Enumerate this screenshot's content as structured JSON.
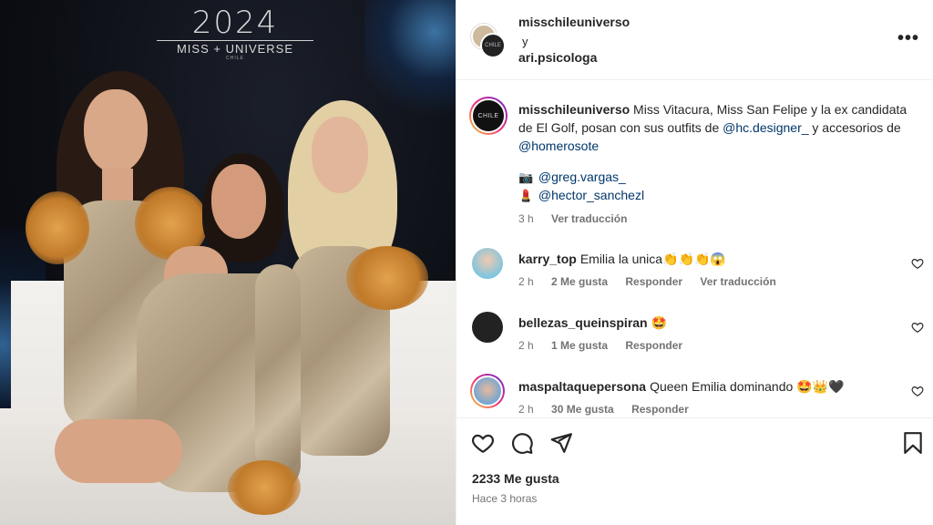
{
  "brand": {
    "year": "2024",
    "name": "MISS + UNIVERSE",
    "sub": "CHILE"
  },
  "header": {
    "user1": "misschileuniverso",
    "connector": "y",
    "user2": "ari.psicologa",
    "more_label": "•••"
  },
  "caption": {
    "username": "misschileuniverso",
    "text_1": " Miss Vitacura, Miss San Felipe y la ex candidata de El Golf, posan con sus outfits de ",
    "mention_1": "@hc.designer_",
    "text_2": " y accesorios de ",
    "mention_2": "@homerosote",
    "credits": [
      {
        "emoji": "📷",
        "handle": "@greg.vargas_"
      },
      {
        "emoji": "💄",
        "handle": "@hector_sanchezl"
      }
    ],
    "time": "3 h",
    "translate": "Ver traducción",
    "avatar_text": "CHILE"
  },
  "comments": [
    {
      "user": "karry_top",
      "text": "Emilia la unica👏👏👏😱",
      "time": "2 h",
      "likes": "2 Me gusta",
      "reply": "Responder",
      "translate": "Ver traducción"
    },
    {
      "user": "bellezas_queinspiran",
      "text": "🤩",
      "time": "2 h",
      "likes": "1 Me gusta",
      "reply": "Responder"
    },
    {
      "user": "maspaltaquepersona",
      "text": "Queen Emilia dominando 🤩👑🖤",
      "time": "2 h",
      "likes": "30 Me gusta",
      "reply": "Responder"
    }
  ],
  "footer": {
    "likes": "2233 Me gusta",
    "time": "Hace 3 horas"
  },
  "colors": {
    "link": "#00376b",
    "muted": "#737373",
    "text": "#262626"
  },
  "icons": [
    "heart-icon",
    "comment-icon",
    "share-icon",
    "bookmark-icon",
    "more-icon"
  ]
}
